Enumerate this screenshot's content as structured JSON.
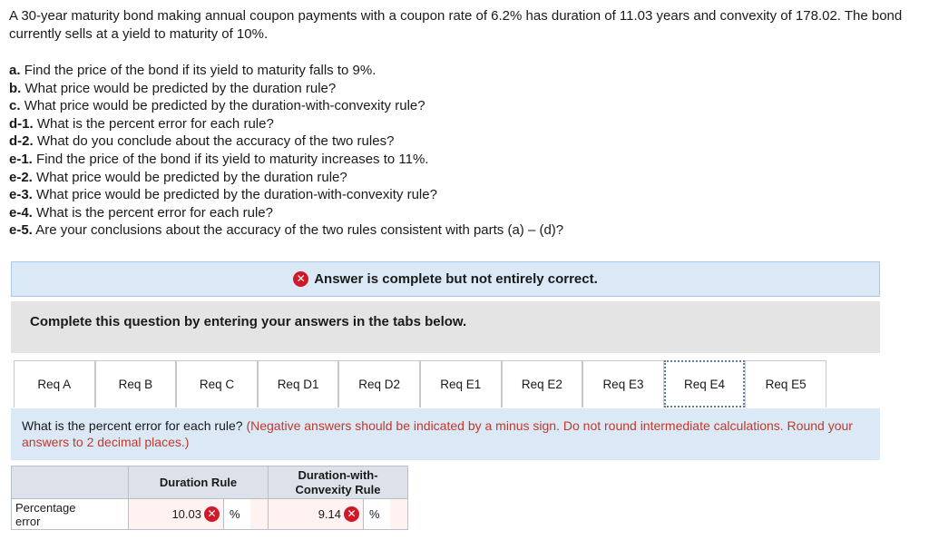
{
  "intro": "A 30-year maturity bond making annual coupon payments with a coupon rate of 6.2% has duration of 11.03 years and convexity of 178.02. The bond currently sells at a yield to maturity of 10%.",
  "parts": [
    {
      "label": "a.",
      "text": "Find the price of the bond if its yield to maturity falls to 9%."
    },
    {
      "label": "b.",
      "text": "What price would be predicted by the duration rule?"
    },
    {
      "label": "c.",
      "text": "What price would be predicted by the duration-with-convexity rule?"
    },
    {
      "label": "d-1.",
      "text": "What is the percent error for each rule?"
    },
    {
      "label": "d-2.",
      "text": "What do you conclude about the accuracy of the two rules?"
    },
    {
      "label": "e-1.",
      "text": "Find the price of the bond if its yield to maturity increases to 11%."
    },
    {
      "label": "e-2.",
      "text": "What price would be predicted by the duration rule?"
    },
    {
      "label": "e-3.",
      "text": "What price would be predicted by the duration-with-convexity rule?"
    },
    {
      "label": "e-4.",
      "text": "What is the percent error for each rule?"
    },
    {
      "label": "e-5.",
      "text": "Are your conclusions about the accuracy of the two rules consistent with parts (a) – (d)?"
    }
  ],
  "banner": {
    "text": "Answer is complete but not entirely correct.",
    "icon": "x-icon"
  },
  "instructions": "Complete this question by entering your answers in the tabs below.",
  "tabs": [
    "Req A",
    "Req B",
    "Req C",
    "Req D1",
    "Req D2",
    "Req E1",
    "Req E2",
    "Req E3",
    "Req E4",
    "Req E5"
  ],
  "active_tab": "Req E4",
  "question": {
    "text": "What is the percent error for each rule?",
    "note": "(Negative answers should be indicated by a minus sign. Do not round intermediate calculations. Round your answers to 2 decimal places.)"
  },
  "table": {
    "col1": "Duration Rule",
    "col2_line1": "Duration-with-",
    "col2_line2": "Convexity Rule",
    "row_label_line1": "Percentage",
    "row_label_line2": "error",
    "duration_value": "10.03",
    "convexity_value": "9.14",
    "unit": "%"
  },
  "colors": {
    "incorrect": "#d0182a",
    "banner_bg": "#dbe9f6",
    "note": "#c0392b"
  }
}
